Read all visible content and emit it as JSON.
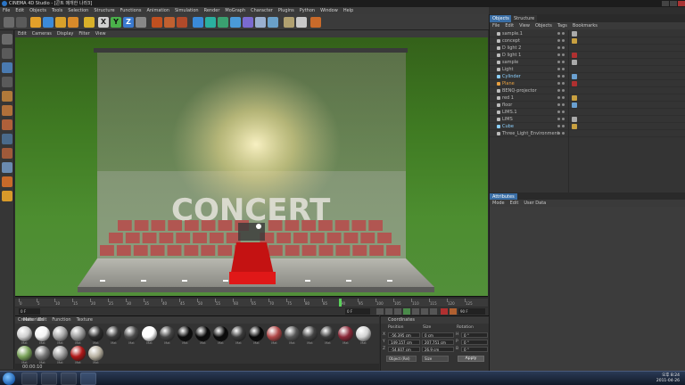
{
  "window": {
    "title": "CINEMA 4D Studio - [콘트 매개한 나라3]"
  },
  "menubar": [
    "File",
    "Edit",
    "Objects",
    "Tools",
    "Selection",
    "Structure",
    "Functions",
    "Animation",
    "Simulation",
    "Render",
    "MoGraph",
    "Character",
    "Plugins",
    "Python",
    "Window",
    "Help"
  ],
  "toolbar": {
    "axis_labels": [
      "X",
      "Y",
      "Z"
    ],
    "icons": [
      "undo-icon",
      "live-select-icon",
      "move-icon",
      "scale-icon",
      "rotate-icon",
      "last-tool-icon",
      "axis-x-icon",
      "axis-y-icon",
      "axis-z-icon",
      "coord-system-icon",
      "render-view-icon",
      "render-picture-viewer-icon",
      "edit-render-settings-icon",
      "cube-icon",
      "spline-pen-icon",
      "subdivision-icon",
      "array-icon",
      "instance-icon",
      "deformer-icon",
      "scene-icon",
      "camera-icon",
      "light-icon",
      "layout-icon"
    ]
  },
  "viewport": {
    "menu": [
      "Edit",
      "Cameras",
      "Display",
      "Filter",
      "View"
    ],
    "sign_text": "CONCERT"
  },
  "timeline": {
    "ticks": [
      0,
      5,
      10,
      15,
      20,
      25,
      30,
      35,
      40,
      45,
      50,
      55,
      60,
      65,
      70,
      75,
      80,
      85,
      90,
      95,
      100,
      105,
      110,
      115,
      120,
      125
    ],
    "current_frame": "0 F",
    "end_frame": "90 F",
    "start_field": "0 F",
    "playhead_frame": 90
  },
  "materials": {
    "menu": [
      "Create",
      "Edit",
      "Function",
      "Texture"
    ],
    "header": "Materials",
    "row1": [
      {
        "label": "Mat",
        "color": "#cfcfcf"
      },
      {
        "label": "Mat",
        "color": "#f4f4f4"
      },
      {
        "label": "Mat",
        "color": "#a9a9a9"
      },
      {
        "label": "Mat",
        "color": "#9a9a9a"
      },
      {
        "label": "Mat",
        "color": "#2c2c2c"
      },
      {
        "label": "Mat",
        "color": "#3a3a3a"
      },
      {
        "label": "Mat",
        "color": "#4a4a4a"
      },
      {
        "label": "Mat",
        "color": "#ffffff"
      },
      {
        "label": "Mat",
        "color": "#444444"
      },
      {
        "label": "Mat",
        "color": "#0c0c0c"
      },
      {
        "label": "Mat",
        "color": "#0a0a0a"
      },
      {
        "label": "Mat",
        "color": "#0a0a0a"
      },
      {
        "label": "Mat",
        "color": "#3a3a3a"
      },
      {
        "label": "Mat",
        "color": "#060606"
      },
      {
        "label": "Mat",
        "color": "#b04848"
      },
      {
        "label": "Mat",
        "color": "#555555"
      },
      {
        "label": "Mat",
        "color": "#444444"
      },
      {
        "label": "Mat",
        "color": "#3a3a3a"
      },
      {
        "label": "Mat",
        "color": "#8a2838"
      },
      {
        "label": "Mat",
        "color": "#d2d2d2"
      }
    ],
    "row2": [
      {
        "label": "Mat",
        "color": "#7aa35a"
      },
      {
        "label": "Mat",
        "color": "#777777"
      },
      {
        "label": "Mat",
        "color": "#9a9a9a"
      },
      {
        "label": "Mat",
        "color": "#b01818"
      },
      {
        "label": "Mat",
        "color": "#b7b0a0"
      }
    ],
    "status": "00:00:10"
  },
  "coordinates": {
    "header": "Coordinates",
    "col_position": "Position",
    "col_size": "Size",
    "col_rotation": "Rotation",
    "rows": [
      {
        "axis": "X",
        "pos": "-56.395 cm",
        "size": "0 cm",
        "rot_axis": "H",
        "rot": "0 °"
      },
      {
        "axis": "Y",
        "pos": "149.157 cm",
        "size": "207.751 cm",
        "rot_axis": "P",
        "rot": "0 °"
      },
      {
        "axis": "Z",
        "pos": "-54.607 cm",
        "size": "26.9 cm",
        "rot_axis": "B",
        "rot": "0 °"
      }
    ],
    "mode_select": "Object (Rel)",
    "size_select": "Size",
    "apply_label": "Apply"
  },
  "objects_panel": {
    "tabs": [
      "Objects",
      "Structure"
    ],
    "menu": [
      "File",
      "Edit",
      "View",
      "Objects",
      "Tags",
      "Bookmarks"
    ],
    "items": [
      {
        "name": "sample.1",
        "color": "#bbbbbb"
      },
      {
        "name": "concept",
        "color": "#bbbbbb"
      },
      {
        "name": "D light 2",
        "color": "#bbbbbb"
      },
      {
        "name": "D light 1",
        "color": "#bbbbbb"
      },
      {
        "name": "sample",
        "color": "#bbbbbb"
      },
      {
        "name": "Light",
        "color": "#bbbbbb"
      },
      {
        "name": "Cylinder",
        "color": "#8ad0ff"
      },
      {
        "name": "Plane",
        "color": "#e8a040"
      },
      {
        "name": "BENQ-projector",
        "color": "#bbbbbb"
      },
      {
        "name": "red 1",
        "color": "#bbbbbb"
      },
      {
        "name": "floor",
        "color": "#bbbbbb"
      },
      {
        "name": "LIMS.1",
        "color": "#bbbbbb"
      },
      {
        "name": "LIMS",
        "color": "#bbbbbb"
      },
      {
        "name": "Cube",
        "color": "#8ad0ff"
      },
      {
        "name": "Three_Light_Environment",
        "color": "#bbbbbb"
      }
    ]
  },
  "attributes_panel": {
    "tab": "Attributes",
    "menu": [
      "Mode",
      "Edit",
      "User Data"
    ]
  },
  "taskbar": {
    "time": "오후 8:24",
    "date": "2011-04-26"
  },
  "colors": {
    "accent_blue": "#3a6ea5",
    "viewport_green": "#4d8e30",
    "seat_red": "#b84a4a",
    "carpet_red": "#c41212"
  }
}
